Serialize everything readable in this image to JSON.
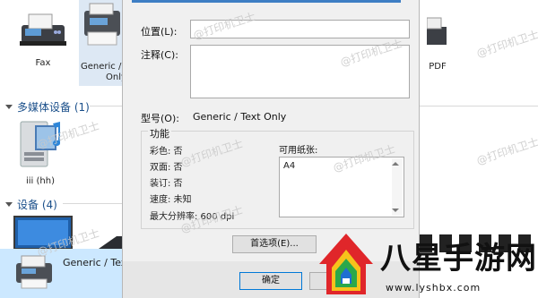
{
  "background": {
    "devices": [
      {
        "label": "Fax"
      },
      {
        "label_line1": "Generic /",
        "label_line2": "Only"
      },
      {
        "label": "PDF"
      }
    ],
    "sections": [
      {
        "title": "多媒体设备 (1)"
      },
      {
        "title": "设备 (4)"
      }
    ],
    "media_device_label": "iii (hh)",
    "selected_printer_label": "Generic / Text O"
  },
  "dialog": {
    "location_label": "位置(L):",
    "location_value": "",
    "comment_label": "注释(C):",
    "comment_value": "",
    "model_label": "型号(O):",
    "model_value": "Generic / Text Only",
    "features_title": "功能",
    "features": [
      "彩色: 否",
      "双面: 否",
      "装订: 否",
      "速度: 未知",
      "最大分辨率: 600 dpi"
    ],
    "paper_label": "可用纸张:",
    "paper_items": [
      "A4"
    ],
    "preferences_button": "首选项(E)...",
    "ok_button": "确定"
  },
  "watermark": {
    "text": "@打印机卫士",
    "logo_text": "八星手游网",
    "logo_url": "www.lyshbx.com"
  },
  "colors": {
    "accent": "#3e7ec4",
    "section_header": "#1a4f8a",
    "selection": "#cce8ff",
    "logo_red": "#e0262a"
  }
}
